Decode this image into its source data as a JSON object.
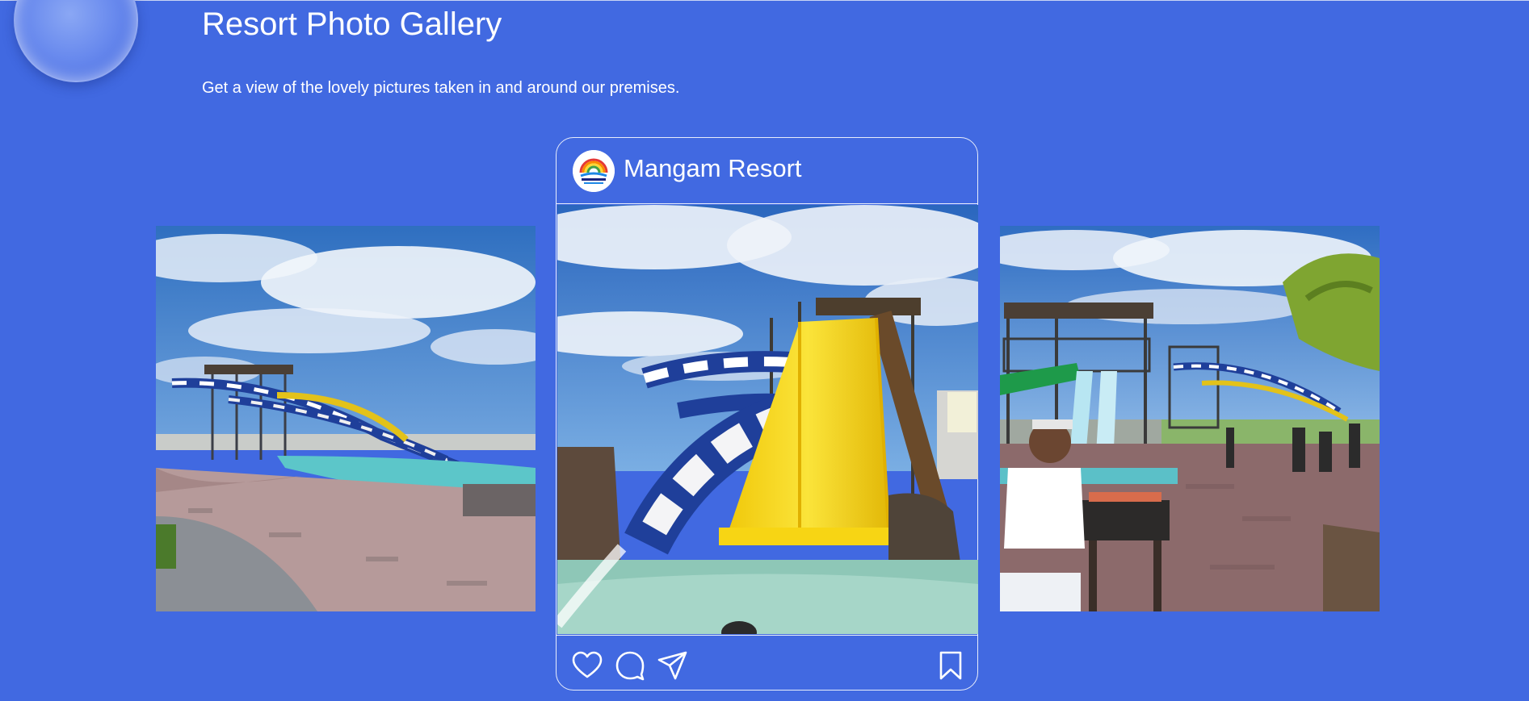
{
  "header": {
    "title": "Resort Photo Gallery",
    "subtitle": "Get a view of the lovely pictures taken in and around our premises."
  },
  "post": {
    "account_name": "Mangam Resort",
    "avatar_icon": "resort-logo-icon",
    "actions": {
      "like_icon": "heart-icon",
      "comment_icon": "comment-bubble-icon",
      "share_icon": "paper-plane-icon",
      "save_icon": "bookmark-icon"
    }
  },
  "gallery": {
    "images": [
      {
        "name": "water-slides-pool-photo",
        "position": "left"
      },
      {
        "name": "yellow-slide-photo",
        "position": "center"
      },
      {
        "name": "slides-and-guests-photo",
        "position": "right"
      }
    ]
  },
  "colors": {
    "background": "#4169e1",
    "text": "#ffffff",
    "slide_yellow": "#f5d712",
    "slide_blue": "#1f3f9a",
    "pool": "#5cc6c9"
  }
}
